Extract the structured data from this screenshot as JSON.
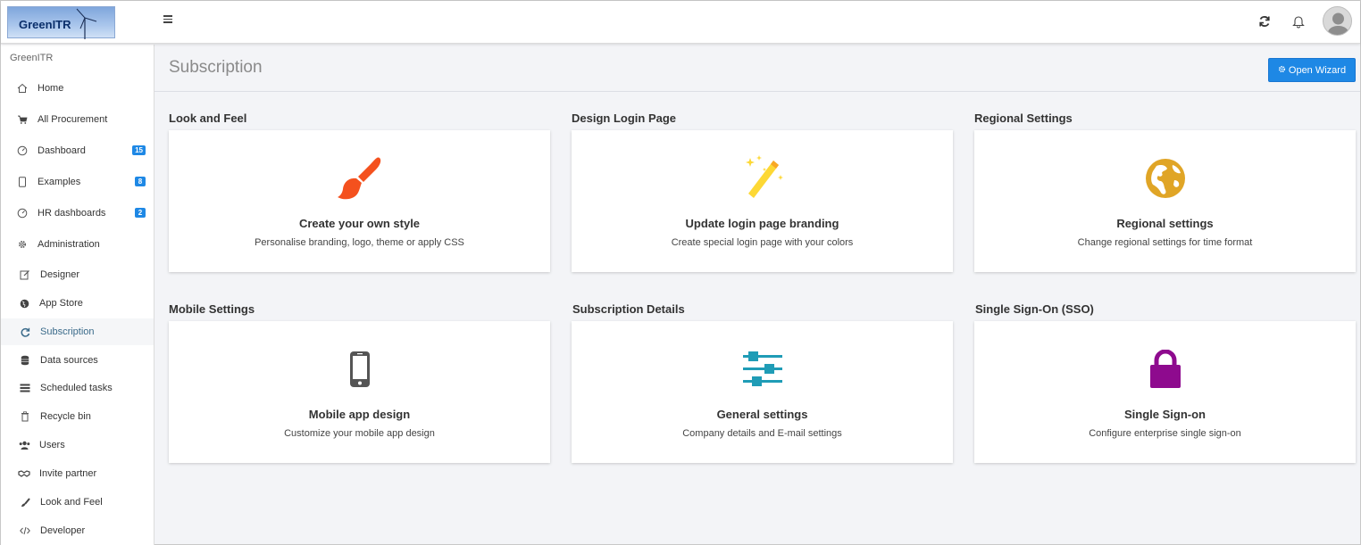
{
  "app": {
    "logo_text": "GreenITR"
  },
  "sidebar": {
    "brand": "GreenITR",
    "items": [
      {
        "label": "Home",
        "icon": "home-icon"
      },
      {
        "label": "All Procurement",
        "icon": "cart-icon"
      },
      {
        "label": "Dashboard",
        "icon": "gauge-icon",
        "badge": "15"
      },
      {
        "label": "Examples",
        "icon": "tablet-icon",
        "badge": "8"
      },
      {
        "label": "HR dashboards",
        "icon": "gauge-icon",
        "badge": "2"
      },
      {
        "label": "Administration",
        "icon": "gear-icon"
      },
      {
        "label": "Designer",
        "icon": "edit-icon"
      },
      {
        "label": "App Store",
        "icon": "globe-icon"
      },
      {
        "label": "Subscription",
        "icon": "refresh-icon",
        "active": true
      },
      {
        "label": "Data sources",
        "icon": "database-icon"
      },
      {
        "label": "Scheduled tasks",
        "icon": "tasks-icon"
      },
      {
        "label": "Recycle bin",
        "icon": "trash-icon"
      },
      {
        "label": "Users",
        "icon": "users-icon"
      },
      {
        "label": "Invite partner",
        "icon": "handshake-icon"
      },
      {
        "label": "Look and Feel",
        "icon": "brush-icon"
      },
      {
        "label": "Developer",
        "icon": "code-icon"
      }
    ]
  },
  "header": {
    "title": "Subscription",
    "wizard_label": "Open Wizard"
  },
  "sections": [
    {
      "section": "Look and Feel",
      "title": "Create your own style",
      "desc": "Personalise branding, logo, theme or apply CSS",
      "icon": "paintbrush-icon",
      "color": "#f4511e"
    },
    {
      "section": "Design Login Page",
      "title": "Update login page branding",
      "desc": "Create special login page with your colors",
      "icon": "magic-wand-icon",
      "color": "#fdd835"
    },
    {
      "section": "Regional Settings",
      "title": "Regional settings",
      "desc": "Change regional settings for time format",
      "icon": "globe-icon",
      "color": "#e0a526"
    },
    {
      "section": "Mobile Settings",
      "title": "Mobile app design",
      "desc": "Customize your mobile app design",
      "icon": "mobile-phone-icon",
      "color": "#555555"
    },
    {
      "section": "Subscription Details",
      "title": "General settings",
      "desc": "Company details and E-mail settings",
      "icon": "sliders-icon",
      "color": "#1f9cb6"
    },
    {
      "section": "Single Sign-On (SSO)",
      "title": "Single Sign-on",
      "desc": "Configure enterprise single sign-on",
      "icon": "lock-icon",
      "color": "#8e0a8e"
    }
  ],
  "colors": {
    "accent": "#1e88e5",
    "badge": "#1e88e5"
  }
}
